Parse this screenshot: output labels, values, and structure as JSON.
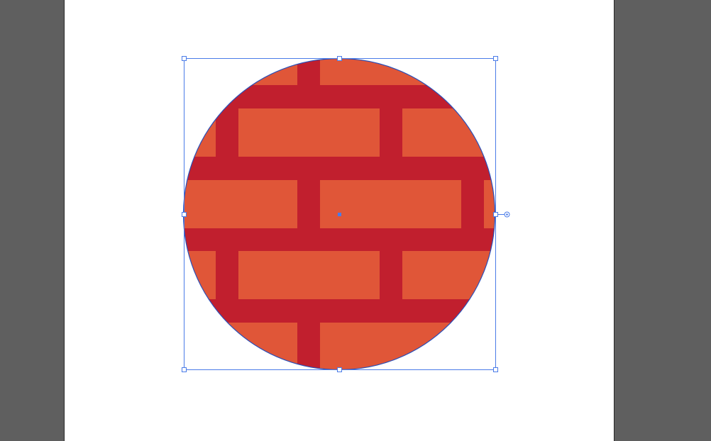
{
  "canvas": {
    "pasteboard_color": "#5f5f5f",
    "artboard_color": "#ffffff"
  },
  "artwork": {
    "shape": "circle",
    "pattern": "brick",
    "brick_color": "#e05638",
    "mortar_color": "#c11f2e",
    "outline_color": "#2a4fb8"
  },
  "selection": {
    "color": "#4a7be8",
    "handles": [
      "top-left",
      "top-center",
      "top-right",
      "middle-left",
      "middle-right",
      "bottom-left",
      "bottom-center",
      "bottom-right"
    ],
    "center_point": true,
    "live_corner_widget": true
  }
}
